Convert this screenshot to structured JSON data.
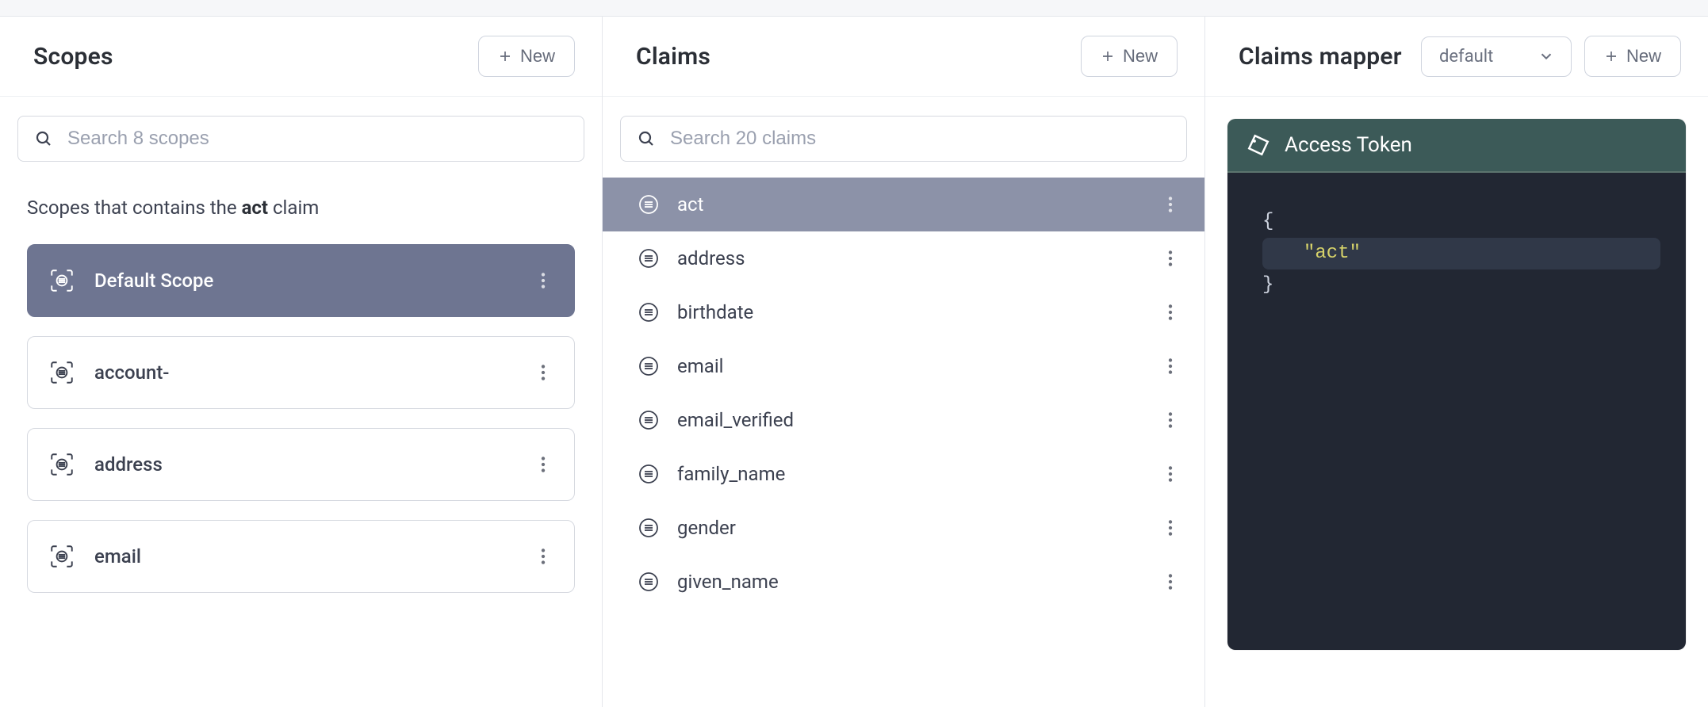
{
  "scopes_panel": {
    "title": "Scopes",
    "new_label": "New",
    "search_placeholder": "Search 8 scopes",
    "helper_prefix": "Scopes that contains the ",
    "helper_highlight": "act",
    "helper_suffix": " claim",
    "items": [
      {
        "label": "Default Scope",
        "active": true
      },
      {
        "label": "account-",
        "active": false
      },
      {
        "label": "address",
        "active": false
      },
      {
        "label": "email",
        "active": false
      }
    ]
  },
  "claims_panel": {
    "title": "Claims",
    "new_label": "New",
    "search_placeholder": "Search 20 claims",
    "items": [
      {
        "label": "act",
        "active": true
      },
      {
        "label": "address",
        "active": false
      },
      {
        "label": "birthdate",
        "active": false
      },
      {
        "label": "email",
        "active": false
      },
      {
        "label": "email_verified",
        "active": false
      },
      {
        "label": "family_name",
        "active": false
      },
      {
        "label": "gender",
        "active": false
      },
      {
        "label": "given_name",
        "active": false
      }
    ]
  },
  "mapper_panel": {
    "title": "Claims mapper",
    "select_value": "default",
    "new_label": "New",
    "token": {
      "header": "Access Token",
      "brace_open": "{",
      "key_line": "\"act\"",
      "brace_close": "}"
    }
  }
}
